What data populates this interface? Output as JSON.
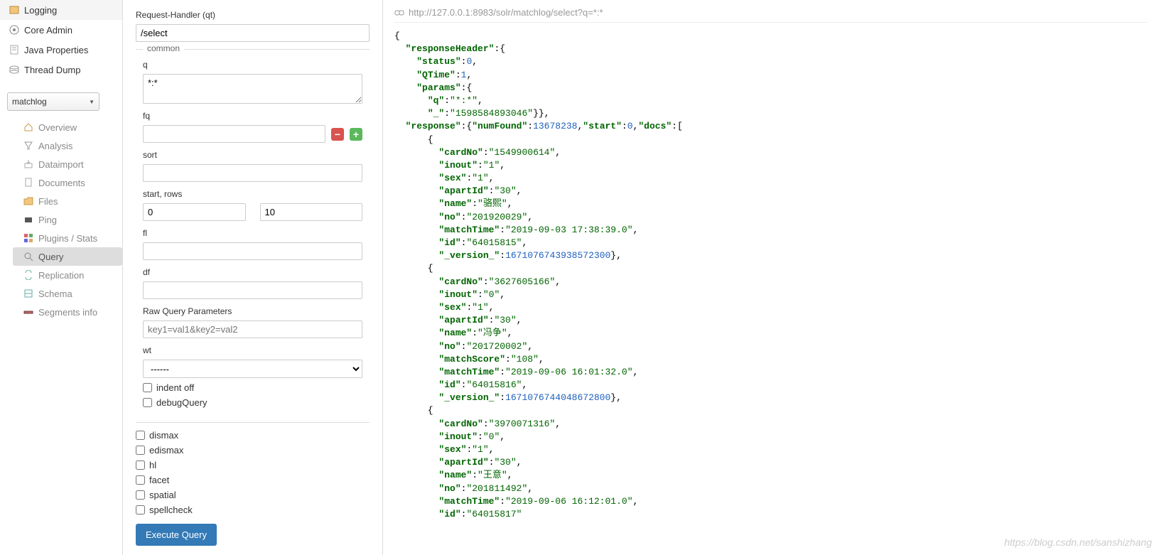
{
  "nav": {
    "logging": "Logging",
    "coreAdmin": "Core Admin",
    "javaProps": "Java Properties",
    "threadDump": "Thread Dump"
  },
  "coreSelect": "matchlog",
  "sub": {
    "overview": "Overview",
    "analysis": "Analysis",
    "dataimport": "Dataimport",
    "documents": "Documents",
    "files": "Files",
    "ping": "Ping",
    "plugins": "Plugins / Stats",
    "query": "Query",
    "replication": "Replication",
    "schema": "Schema",
    "segments": "Segments info"
  },
  "form": {
    "qtLabel": "Request-Handler (qt)",
    "qt": "/select",
    "common": "common",
    "qLabel": "q",
    "q": "*:*",
    "fqLabel": "fq",
    "fq": "",
    "sortLabel": "sort",
    "sort": "",
    "startRowsLabel": "start, rows",
    "start": "0",
    "rows": "10",
    "flLabel": "fl",
    "fl": "",
    "dfLabel": "df",
    "df": "",
    "rawLabel": "Raw Query Parameters",
    "rawPlaceholder": "key1=val1&key2=val2",
    "wtLabel": "wt",
    "wt": "------",
    "indentOff": "indent off",
    "debugQuery": "debugQuery",
    "dismax": "dismax",
    "edismax": "edismax",
    "hl": "hl",
    "facet": "facet",
    "spatial": "spatial",
    "spellcheck": "spellcheck",
    "execute": "Execute Query"
  },
  "url": "http://127.0.0.1:8983/solr/matchlog/select?q=*:*",
  "response": {
    "header": {
      "status": 0,
      "QTime": 1,
      "params": {
        "q": "*:*",
        "_": "1598584893046"
      }
    },
    "numFound": 13678238,
    "start": 0,
    "docs": [
      {
        "cardNo": "1549900614",
        "inout": "1",
        "sex": "1",
        "apartId": "30",
        "name": "骆熙",
        "no": "201920029",
        "matchTime": "2019-09-03 17:38:39.0",
        "id": "64015815",
        "_version_": 1671076743938572288
      },
      {
        "cardNo": "3627605166",
        "inout": "0",
        "sex": "1",
        "apartId": "30",
        "name": "冯争",
        "no": "201720002",
        "matchScore": "108",
        "matchTime": "2019-09-06 16:01:32.0",
        "id": "64015816",
        "_version_": 1671076744048672768
      },
      {
        "cardNo": "3970071316",
        "inout": "0",
        "sex": "1",
        "apartId": "30",
        "name": "王意",
        "no": "201811492",
        "matchTime": "2019-09-06 16:12:01.0",
        "id": "64015817"
      }
    ]
  },
  "watermark": "https://blog.csdn.net/sanshizhang"
}
